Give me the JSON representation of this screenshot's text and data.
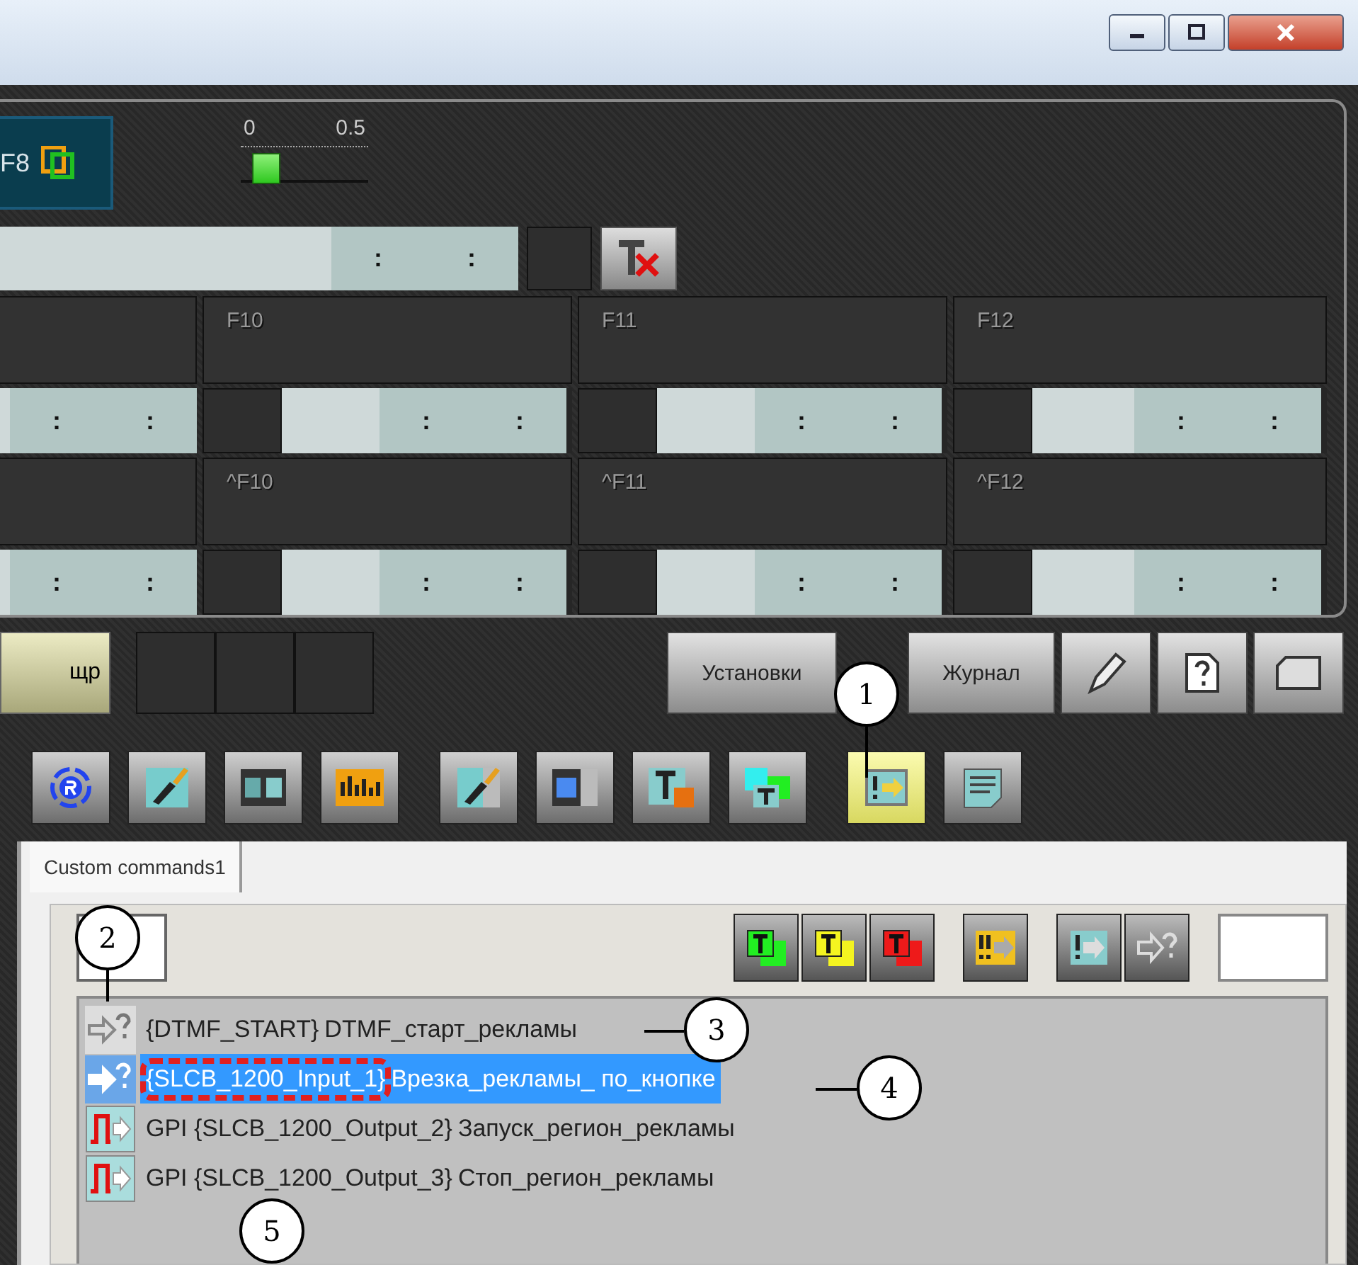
{
  "f8_panel": {
    "key_label": "F8"
  },
  "volume_slider": {
    "scale": [
      "0",
      "0.5"
    ],
    "level": 0.12
  },
  "main_timecode": {
    "separators": [
      ":",
      ":"
    ]
  },
  "hotkey_grid": {
    "rows": [
      {
        "kind": "keys",
        "cells": [
          {},
          {
            "label": "F10"
          },
          {
            "label": "F11"
          },
          {
            "label": "F12"
          }
        ]
      },
      {
        "kind": "timecodes",
        "cells": [
          {
            "separators": [
              ":",
              ":"
            ]
          },
          {
            "separators": [
              ":",
              ":"
            ]
          },
          {
            "separators": [
              ":",
              ":"
            ]
          },
          {
            "separators": [
              ":",
              ":"
            ]
          }
        ]
      },
      {
        "kind": "keys",
        "cells": [
          {},
          {
            "label": "^F10"
          },
          {
            "label": "^F11"
          },
          {
            "label": "^F12"
          }
        ]
      },
      {
        "kind": "timecodes",
        "cells": [
          {
            "separators": [
              ":",
              ":"
            ]
          },
          {
            "separators": [
              ":",
              ":"
            ]
          },
          {
            "separators": [
              ":",
              ":"
            ]
          },
          {
            "separators": [
              ":",
              ":"
            ]
          }
        ]
      }
    ]
  },
  "bottom_buttons": {
    "left_button": "щр",
    "right_buttons": [
      {
        "kind": "text",
        "label": "Установки"
      },
      {
        "kind": "text",
        "label": "Журнал"
      },
      {
        "kind": "pen"
      },
      {
        "kind": "help"
      },
      {
        "kind": "folder"
      }
    ]
  },
  "toolbar": {
    "groups": [
      [
        {
          "kind": "registered",
          "selected": false
        },
        {
          "kind": "brush",
          "selected": false
        },
        {
          "kind": "film",
          "selected": false
        },
        {
          "kind": "equalizer",
          "selected": false
        }
      ],
      [
        {
          "kind": "brush-checker",
          "selected": false
        },
        {
          "kind": "film-checker",
          "selected": false
        },
        {
          "kind": "text-orange",
          "selected": false
        },
        {
          "kind": "text-multi",
          "selected": false
        }
      ],
      [
        {
          "kind": "command",
          "selected": true
        },
        {
          "kind": "notes",
          "selected": false
        }
      ]
    ]
  },
  "tabs": [
    {
      "label": "Custom commands1",
      "selected": true
    }
  ],
  "command_toolbar": {
    "groups": [
      [
        {
          "kind": "t-green"
        },
        {
          "kind": "t-yellow"
        },
        {
          "kind": "t-red"
        }
      ],
      [
        {
          "kind": "double-command"
        }
      ],
      [
        {
          "kind": "command"
        },
        {
          "kind": "query"
        }
      ]
    ]
  },
  "commands": [
    {
      "kind": "dtmf",
      "code": "{DTMF_START}",
      "name": "DTMF_старт_рекламы",
      "selected": false,
      "marked": false
    },
    {
      "kind": "dtmf",
      "code": "{SLCB_1200_Input_1}",
      "name": "Врезка_рекламы_ по_кнопке",
      "selected": true,
      "marked": true
    },
    {
      "kind": "gpi",
      "code": "GPI {SLCB_1200_Output_2}",
      "name": "Запуск_регион_рекламы",
      "selected": false,
      "marked": false
    },
    {
      "kind": "gpi",
      "code": "GPI {SLCB_1200_Output_3}",
      "name": "Стоп_регион_рекламы",
      "selected": false,
      "marked": false
    }
  ],
  "callouts": [
    "1",
    "2",
    "3",
    "4",
    "5"
  ]
}
